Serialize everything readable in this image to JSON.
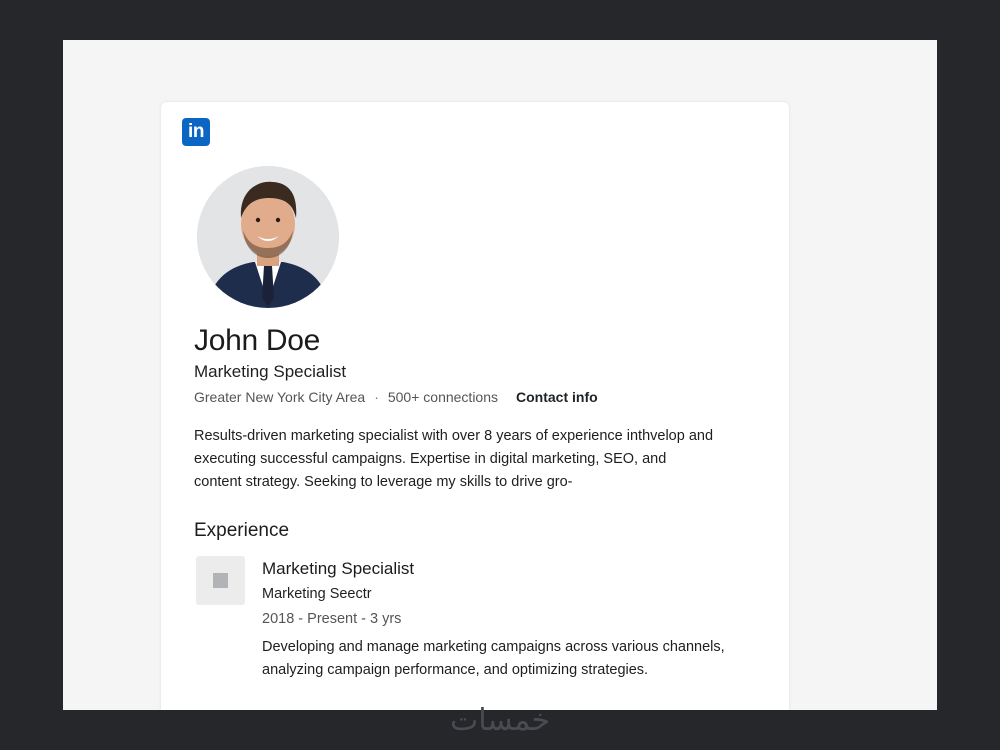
{
  "brand": {
    "logo_text": "in",
    "color": "#0a66c2"
  },
  "profile": {
    "name": "John Doe",
    "headline": "Marketing Specialist",
    "location": "Greater New York City Area",
    "separator": "·",
    "connections": "500+ connections",
    "contact_label": "Contact info",
    "summary_lines": [
      "Results-driven marketing specialist with over 8 years of experience inthvelop and",
      "executing successful campaigns. Expertise in digital marketing, SEO, and",
      "content strategy. Seeking to leverage my skills to drive gro-"
    ]
  },
  "experience": {
    "section_title": "Experience",
    "items": [
      {
        "title": "Marketing Specialist",
        "company": "Marketing Seectr",
        "dates": "2018 - Present - 3 yrs",
        "description_lines": [
          "Developing and manage marketing campaigns across various channels,",
          "analyzing campaign performance, and optimizing strategies."
        ]
      }
    ]
  },
  "watermark": {
    "text": "خمسات"
  }
}
